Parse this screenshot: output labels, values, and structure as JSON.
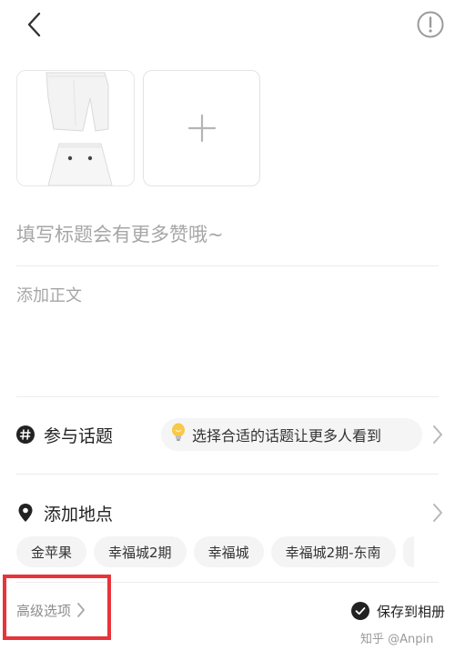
{
  "images": {
    "add_symbol": "+"
  },
  "title": {
    "placeholder": "填写标题会有更多赞哦~"
  },
  "body": {
    "placeholder": "添加正文"
  },
  "topic": {
    "label": "参与话题",
    "icon": "hashtag-icon",
    "hint": "选择合适的话题让更多人看到",
    "hint_icon": "lightbulb-icon"
  },
  "location": {
    "label": "添加地点",
    "icon": "location-pin-icon",
    "chips": [
      "金苹果",
      "幸福城2期",
      "幸福城",
      "幸福城2期-东南"
    ]
  },
  "footer": {
    "advanced_label": "高级选项",
    "save_label": "保存到相册",
    "watermark": "知乎 @Anpin"
  },
  "colors": {
    "highlight": "#e8333a",
    "placeholder": "#a6a6a6",
    "chip_bg": "#f4f4f4"
  }
}
